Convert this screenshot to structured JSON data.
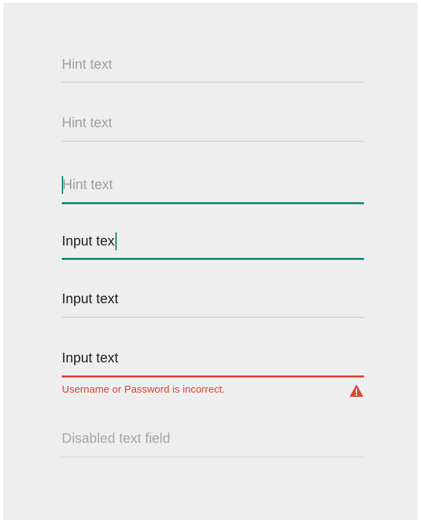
{
  "fields": [
    {
      "state": "hint",
      "placeholder": "Hint text"
    },
    {
      "state": "hint",
      "placeholder": "Hint text"
    },
    {
      "state": "focused-empty",
      "placeholder": "Hint text"
    },
    {
      "state": "focused-typing",
      "value": "Input tex"
    },
    {
      "state": "filled",
      "value": "Input text"
    },
    {
      "state": "error",
      "value": "Input text",
      "error_message": "Username or Password is incorrect.",
      "error_icon": "warning-triangle-icon"
    },
    {
      "state": "disabled",
      "placeholder": "Disabled text field"
    }
  ],
  "colors": {
    "panel_background": "#eeeeee",
    "hint_text": "#9e9e9e",
    "input_text": "#212121",
    "underline": "#c8c8c8",
    "focus_accent": "#168b7d",
    "error": "#d84535"
  }
}
